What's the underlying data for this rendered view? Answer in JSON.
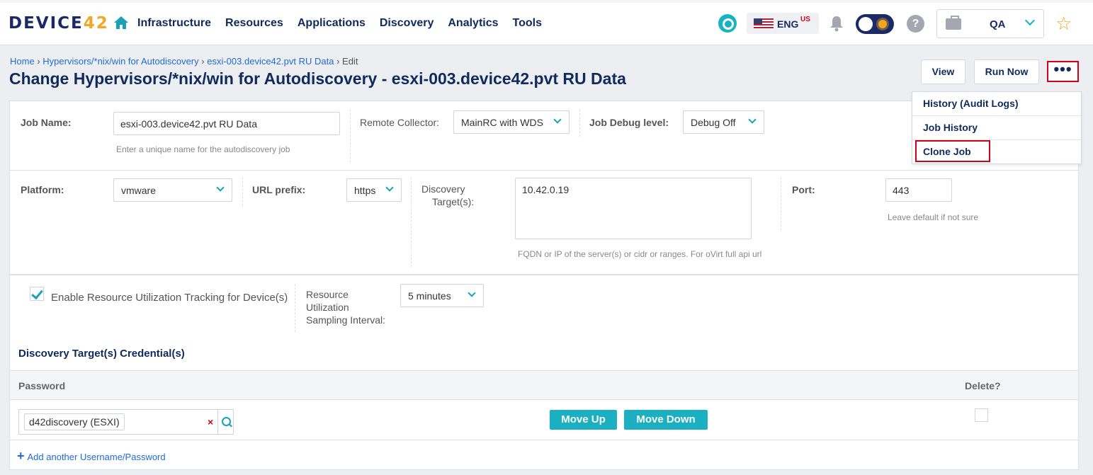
{
  "brand": {
    "logo_text": "DEVICE",
    "logo_num": "42"
  },
  "nav": [
    "Infrastructure",
    "Resources",
    "Applications",
    "Discovery",
    "Analytics",
    "Tools"
  ],
  "lang": {
    "code": "ENG",
    "region": "US"
  },
  "help_label": "?",
  "tenant": "QA",
  "star": "☆",
  "breadcrumb": {
    "home": "Home",
    "section": "Hypervisors/*nix/win for Autodiscovery",
    "item": "esxi-003.device42.pvt RU Data",
    "current": "Edit",
    "sep": "›"
  },
  "page_title": "Change Hypervisors/*nix/win for Autodiscovery - esxi-003.device42.pvt RU Data",
  "actions": {
    "view": "View",
    "run_now": "Run Now",
    "more": "•••"
  },
  "menu": [
    "History (Audit Logs)",
    "Job History",
    "Clone Job"
  ],
  "form": {
    "job_name_label": "Job Name:",
    "job_name_value": "esxi-003.device42.pvt RU Data",
    "job_name_hint": "Enter a unique name for the autodiscovery job",
    "remote_collector_label": "Remote Collector:",
    "remote_collector_value": "MainRC with WDS",
    "debug_label": "Job Debug level:",
    "debug_value": "Debug Off",
    "platform_label": "Platform:",
    "platform_value": "vmware",
    "url_prefix_label": "URL prefix:",
    "url_prefix_value": "https",
    "targets_label_1": "Discovery",
    "targets_label_2": "Target(s):",
    "targets_value": "10.42.0.19",
    "targets_hint": "FQDN or IP of the server(s) or cidr or ranges. For oVirt full api url",
    "port_label": "Port:",
    "port_value": "443",
    "port_hint": "Leave default if not sure",
    "util_tracking_label": "Enable Resource Utilization Tracking for Device(s)",
    "interval_label_1": "Resource",
    "interval_label_2": "Utilization",
    "interval_label_3": "Sampling Interval:",
    "interval_value": "5 minutes"
  },
  "credentials": {
    "title": "Discovery Target(s) Credential(s)",
    "col_password": "Password",
    "col_delete": "Delete?",
    "value": "d42discovery (ESXI)",
    "remove": "×",
    "move_up": "Move Up",
    "move_down": "Move Down",
    "add_plus": "+",
    "add_link": "Add another Username/Password"
  }
}
